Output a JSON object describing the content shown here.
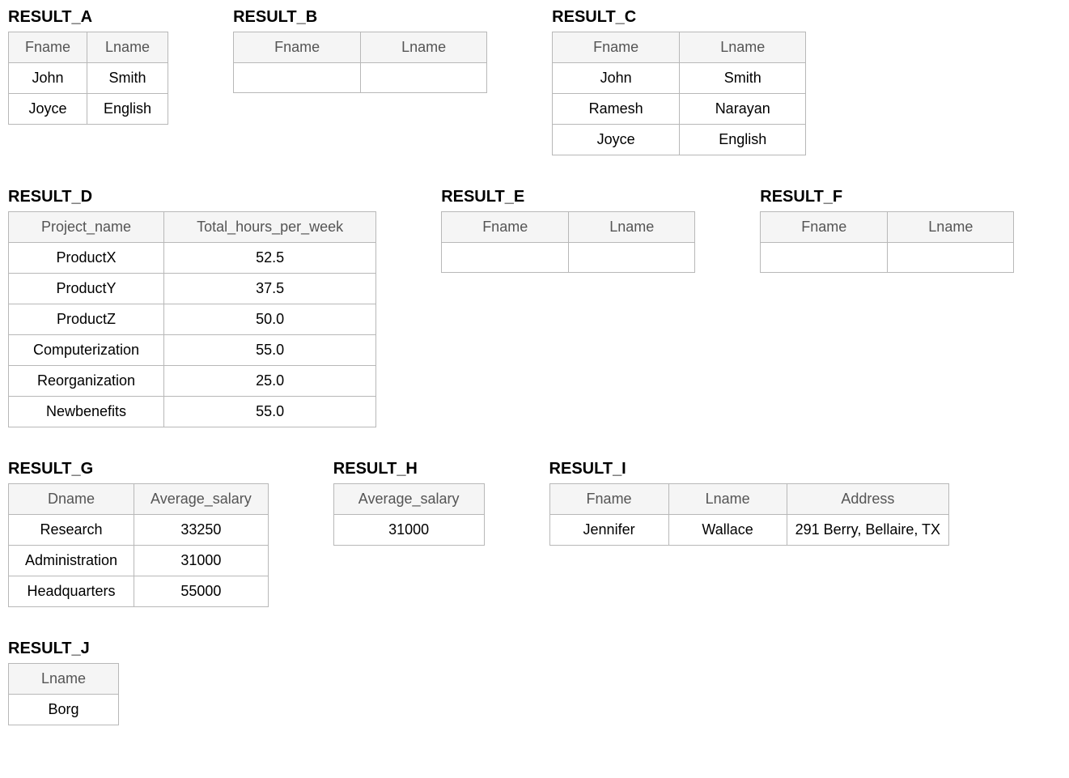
{
  "result_a": {
    "title": "RESULT_A",
    "columns": [
      "Fname",
      "Lname"
    ],
    "rows": [
      [
        "John",
        "Smith"
      ],
      [
        "Joyce",
        "English"
      ]
    ]
  },
  "result_b": {
    "title": "RESULT_B",
    "columns": [
      "Fname",
      "Lname"
    ],
    "rows": [
      [
        "",
        ""
      ]
    ]
  },
  "result_c": {
    "title": "RESULT_C",
    "columns": [
      "Fname",
      "Lname"
    ],
    "rows": [
      [
        "John",
        "Smith"
      ],
      [
        "Ramesh",
        "Narayan"
      ],
      [
        "Joyce",
        "English"
      ]
    ]
  },
  "result_d": {
    "title": "RESULT_D",
    "columns": [
      "Project_name",
      "Total_hours_per_week"
    ],
    "rows": [
      [
        "ProductX",
        "52.5"
      ],
      [
        "ProductY",
        "37.5"
      ],
      [
        "ProductZ",
        "50.0"
      ],
      [
        "Computerization",
        "55.0"
      ],
      [
        "Reorganization",
        "25.0"
      ],
      [
        "Newbenefits",
        "55.0"
      ]
    ]
  },
  "result_e": {
    "title": "RESULT_E",
    "columns": [
      "Fname",
      "Lname"
    ],
    "rows": [
      [
        "",
        ""
      ]
    ]
  },
  "result_f": {
    "title": "RESULT_F",
    "columns": [
      "Fname",
      "Lname"
    ],
    "rows": [
      [
        "",
        ""
      ]
    ]
  },
  "result_g": {
    "title": "RESULT_G",
    "columns": [
      "Dname",
      "Average_salary"
    ],
    "rows": [
      [
        "Research",
        "33250"
      ],
      [
        "Administration",
        "31000"
      ],
      [
        "Headquarters",
        "55000"
      ]
    ]
  },
  "result_h": {
    "title": "RESULT_H",
    "columns": [
      "Average_salary"
    ],
    "rows": [
      [
        "31000"
      ]
    ]
  },
  "result_i": {
    "title": "RESULT_I",
    "columns": [
      "Fname",
      "Lname",
      "Address"
    ],
    "rows": [
      [
        "Jennifer",
        "Wallace",
        "291 Berry, Bellaire, TX"
      ]
    ]
  },
  "result_j": {
    "title": "RESULT_J",
    "columns": [
      "Lname"
    ],
    "rows": [
      [
        "Borg"
      ]
    ]
  }
}
